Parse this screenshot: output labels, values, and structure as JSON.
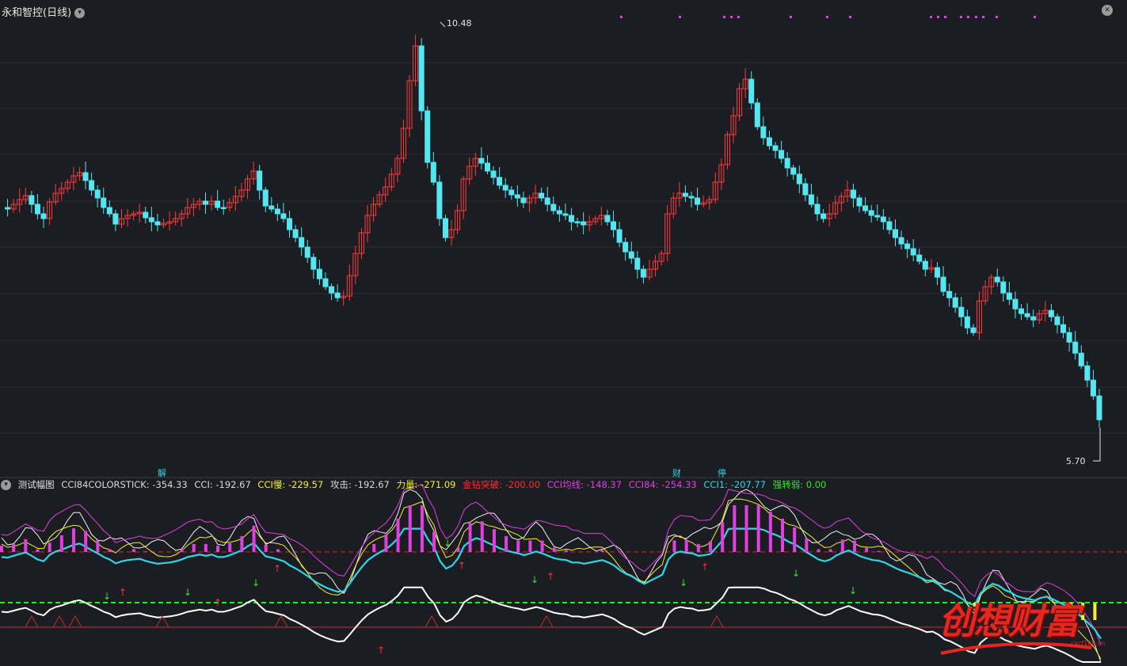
{
  "header": {
    "title": "永和智控(日线)",
    "dropdown_icon": "chevron-down-icon",
    "close_icon": "close-icon"
  },
  "main_chart": {
    "high_label": "10.48",
    "low_label": "5.70",
    "markers": [
      "解",
      "财",
      "停"
    ],
    "up_color": "#ff3b3b",
    "down_color": "#54e7f2"
  },
  "indicator": {
    "name": "测试幅图",
    "items": [
      {
        "label": "CCI84COLORSTICK: -354.33",
        "color": "#d8d8d8"
      },
      {
        "label": "CCI: -192.67",
        "color": "#d8d8d8"
      },
      {
        "label": "CCI慢: -229.57",
        "color": "#f2ef35"
      },
      {
        "label": "攻击: -192.67",
        "color": "#d8d8d8"
      },
      {
        "label": "力量: -271.09",
        "color": "#f2ef35"
      },
      {
        "label": "金钻突破: -200.00",
        "color": "#ff3030"
      },
      {
        "label": "CCI均线: -148.37",
        "color": "#e040e0"
      },
      {
        "label": "CCI84: -254.33",
        "color": "#e040e0"
      },
      {
        "label": "CCI1: -207.77",
        "color": "#2fd6e8"
      },
      {
        "label": "强转弱: 0.00",
        "color": "#2ee62e"
      }
    ]
  },
  "watermark": {
    "text": "创想财富",
    "url": "cxcf168.cn"
  }
}
